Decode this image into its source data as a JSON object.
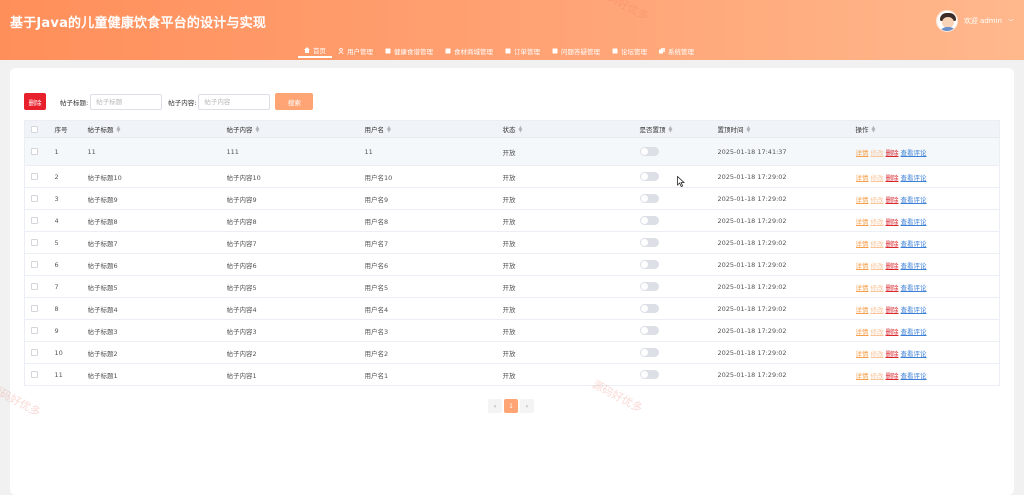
{
  "header": {
    "title": "基于Java的儿童健康饮食平台的设计与实现",
    "user_label": "欢迎 admin",
    "nav": [
      {
        "label": "首页",
        "icon": "home-icon",
        "active": true
      },
      {
        "label": "用户管理",
        "icon": "user-icon"
      },
      {
        "label": "健康食谱管理",
        "icon": "recipe-icon"
      },
      {
        "label": "食材商城管理",
        "icon": "shop-icon"
      },
      {
        "label": "订单管理",
        "icon": "order-icon"
      },
      {
        "label": "问题答疑管理",
        "icon": "qa-icon"
      },
      {
        "label": "论坛管理",
        "icon": "forum-icon"
      },
      {
        "label": "系统管理",
        "icon": "system-icon"
      }
    ]
  },
  "search": {
    "delete_label": "删除",
    "title_label": "帖子标题:",
    "title_placeholder": "帖子标题",
    "content_label": "帖子内容:",
    "content_placeholder": "帖子内容",
    "search_label": "搜索"
  },
  "table": {
    "columns": [
      "序号",
      "帖子标题",
      "帖子内容",
      "用户名",
      "状态",
      "是否置顶",
      "置顶时间",
      "操作"
    ],
    "actions": {
      "detail": "详情",
      "edit": "修改",
      "delete": "删除",
      "comments": "查看评论"
    },
    "rows": [
      {
        "no": "1",
        "title": "11",
        "content": "111",
        "user": "11",
        "status": "开放",
        "time": "2025-01-18 17:41:37"
      },
      {
        "no": "2",
        "title": "帖子标题10",
        "content": "帖子内容10",
        "user": "用户名10",
        "status": "开放",
        "time": "2025-01-18 17:29:02"
      },
      {
        "no": "3",
        "title": "帖子标题9",
        "content": "帖子内容9",
        "user": "用户名9",
        "status": "开放",
        "time": "2025-01-18 17:29:02"
      },
      {
        "no": "4",
        "title": "帖子标题8",
        "content": "帖子内容8",
        "user": "用户名8",
        "status": "开放",
        "time": "2025-01-18 17:29:02"
      },
      {
        "no": "5",
        "title": "帖子标题7",
        "content": "帖子内容7",
        "user": "用户名7",
        "status": "开放",
        "time": "2025-01-18 17:29:02"
      },
      {
        "no": "6",
        "title": "帖子标题6",
        "content": "帖子内容6",
        "user": "用户名6",
        "status": "开放",
        "time": "2025-01-18 17:29:02"
      },
      {
        "no": "7",
        "title": "帖子标题5",
        "content": "帖子内容5",
        "user": "用户名5",
        "status": "开放",
        "time": "2025-01-18 17:29:02"
      },
      {
        "no": "8",
        "title": "帖子标题4",
        "content": "帖子内容4",
        "user": "用户名4",
        "status": "开放",
        "time": "2025-01-18 17:29:02"
      },
      {
        "no": "9",
        "title": "帖子标题3",
        "content": "帖子内容3",
        "user": "用户名3",
        "status": "开放",
        "time": "2025-01-18 17:29:02"
      },
      {
        "no": "10",
        "title": "帖子标题2",
        "content": "帖子内容2",
        "user": "用户名2",
        "status": "开放",
        "time": "2025-01-18 17:29:02"
      },
      {
        "no": "11",
        "title": "帖子标题1",
        "content": "帖子内容1",
        "user": "用户名1",
        "status": "开放",
        "time": "2025-01-18 17:29:02"
      }
    ]
  },
  "pagination": {
    "prev": "‹",
    "current": "1",
    "next": "›"
  },
  "watermark": "源码好优多"
}
